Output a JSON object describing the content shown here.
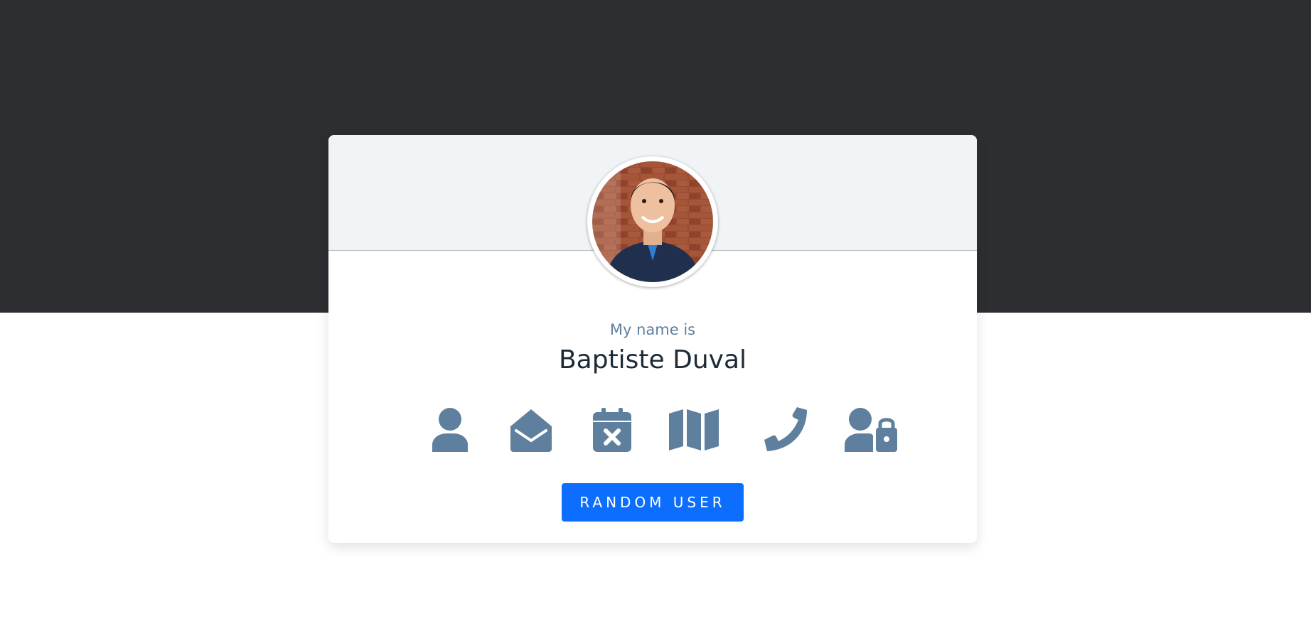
{
  "profile": {
    "intro_label": "My name is",
    "name": "Baptiste Duval"
  },
  "icons": [
    {
      "name": "user-icon"
    },
    {
      "name": "envelope-open-icon"
    },
    {
      "name": "calendar-x-icon"
    },
    {
      "name": "map-icon"
    },
    {
      "name": "phone-icon"
    },
    {
      "name": "user-lock-icon"
    }
  ],
  "button": {
    "label": "RANDOM USER"
  },
  "colors": {
    "background_dark": "#2d2e32",
    "card_header": "#f0f4f7",
    "icon": "#5f7f9e",
    "accent": "#0d6efd",
    "name_text": "#1d2a36"
  }
}
